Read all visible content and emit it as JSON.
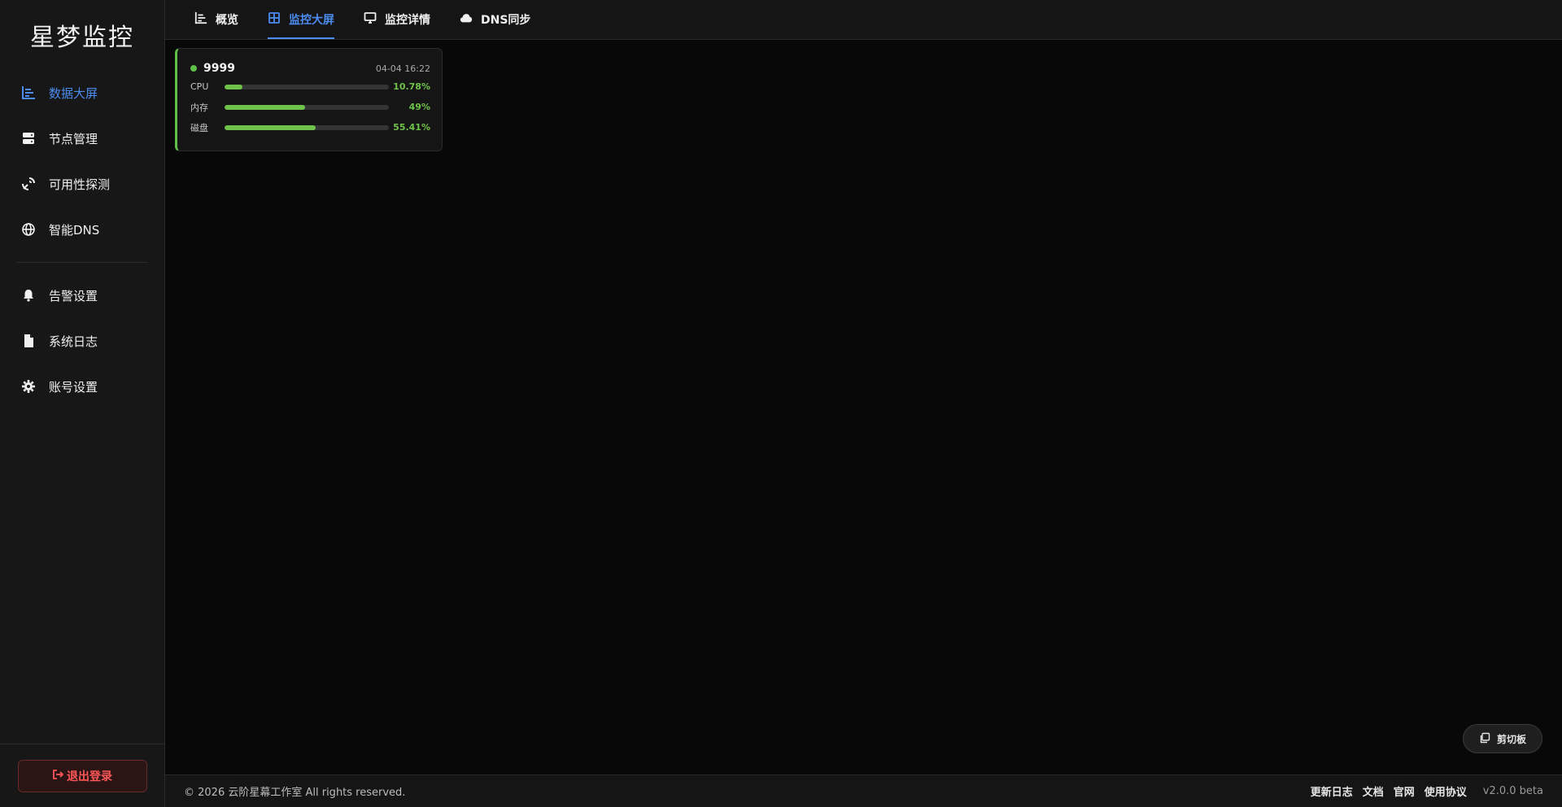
{
  "brand": {
    "title": "星梦监控"
  },
  "sidebar": {
    "items": [
      {
        "label": "数据大屏",
        "icon": "chart-bar-icon",
        "active": true
      },
      {
        "label": "节点管理",
        "icon": "server-icon"
      },
      {
        "label": "可用性探测",
        "icon": "satellite-dish-icon"
      },
      {
        "label": "智能DNS",
        "icon": "globe-icon"
      },
      {
        "label": "告警设置",
        "icon": "bell-icon"
      },
      {
        "label": "系统日志",
        "icon": "file-icon"
      },
      {
        "label": "账号设置",
        "icon": "gear-icon"
      }
    ],
    "logout_label": "退出登录"
  },
  "tabs": [
    {
      "label": "概览",
      "icon": "chart-bar-icon"
    },
    {
      "label": "监控大屏",
      "icon": "grid-icon",
      "active": true
    },
    {
      "label": "监控详情",
      "icon": "monitor-icon"
    },
    {
      "label": "DNS同步",
      "icon": "cloud-icon"
    }
  ],
  "node": {
    "name": "9999",
    "time": "04-04 16:22",
    "status_color": "#5fbf46",
    "metrics": [
      {
        "label": "CPU",
        "value_text": "10.78%",
        "percent": 10.78
      },
      {
        "label": "内存",
        "value_text": "49%",
        "percent": 49
      },
      {
        "label": "磁盘",
        "value_text": "55.41%",
        "percent": 55.41
      }
    ]
  },
  "clipboard": {
    "label": "剪切板",
    "icon": "clipboard-icon"
  },
  "footer": {
    "copyright": "© 2026 云阶星幕工作室 All rights reserved.",
    "links": [
      "更新日志",
      "文档",
      "官网",
      "使用协议"
    ],
    "version": "v2.0.0 beta"
  },
  "colors": {
    "accent": "#4c8cf0",
    "success": "#6fc24a",
    "danger": "#ff5757"
  }
}
